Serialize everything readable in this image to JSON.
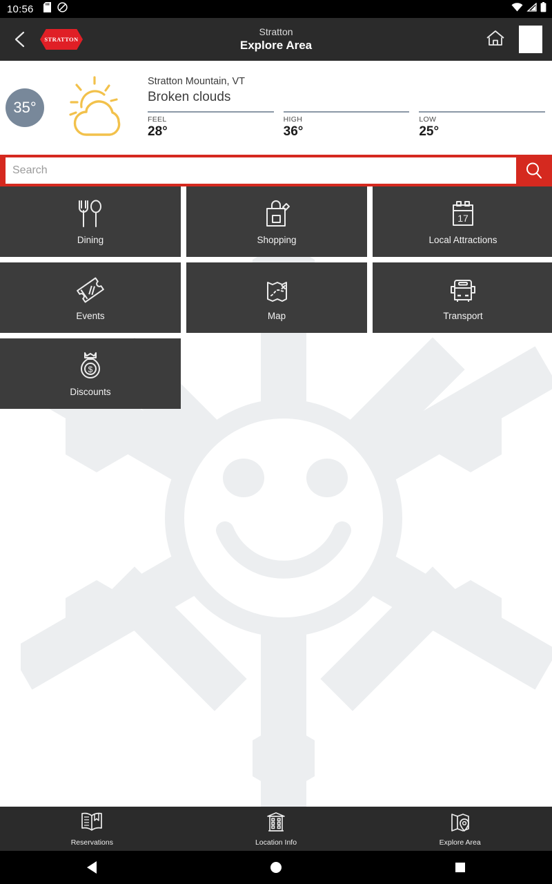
{
  "status_bar": {
    "time": "10:56",
    "icons": [
      "sd-card-icon",
      "do-not-disturb-icon",
      "wifi-icon",
      "cell-signal-icon",
      "battery-icon"
    ]
  },
  "header": {
    "back_icon": "chevron-left-icon",
    "brand": "STRATTON",
    "title_sub": "Stratton",
    "title_main": "Explore Area",
    "home_icon": "home-icon",
    "menu_icon": "white-square-icon"
  },
  "weather": {
    "current_temp": "35°",
    "condition_icon": "sun-behind-cloud-icon",
    "city": "Stratton Mountain, VT",
    "description": "Broken clouds",
    "stats": [
      {
        "label": "FEEL",
        "value": "28°"
      },
      {
        "label": "HIGH",
        "value": "36°"
      },
      {
        "label": "LOW",
        "value": "25°"
      }
    ]
  },
  "search": {
    "placeholder": "Search",
    "value": "",
    "icon": "search-icon"
  },
  "tiles": [
    {
      "label": "Dining",
      "icon": "fork-and-spoon-icon"
    },
    {
      "label": "Shopping",
      "icon": "shopping-bag-icon"
    },
    {
      "label": "Local Attractions",
      "icon": "calendar-17-icon"
    },
    {
      "label": "Events",
      "icon": "ticket-icon"
    },
    {
      "label": "Map",
      "icon": "treasure-map-icon"
    },
    {
      "label": "Transport",
      "icon": "bus-icon"
    },
    {
      "label": "Discounts",
      "icon": "money-bag-icon"
    }
  ],
  "bottom_nav": [
    {
      "label": "Reservations",
      "icon": "open-book-icon"
    },
    {
      "label": "Location Info",
      "icon": "building-icon"
    },
    {
      "label": "Explore Area",
      "icon": "map-pin-icon"
    }
  ],
  "android_nav": {
    "back": "back-triangle-icon",
    "home": "home-circle-icon",
    "recents": "recents-square-icon"
  },
  "colors": {
    "brand_red": "#d5291f",
    "tile_bg": "#3c3c3c",
    "header_bg": "#2b2b2b",
    "temp_bubble": "#78889a",
    "weather_icon": "#f2c14b",
    "watermark": "#eceef0"
  }
}
